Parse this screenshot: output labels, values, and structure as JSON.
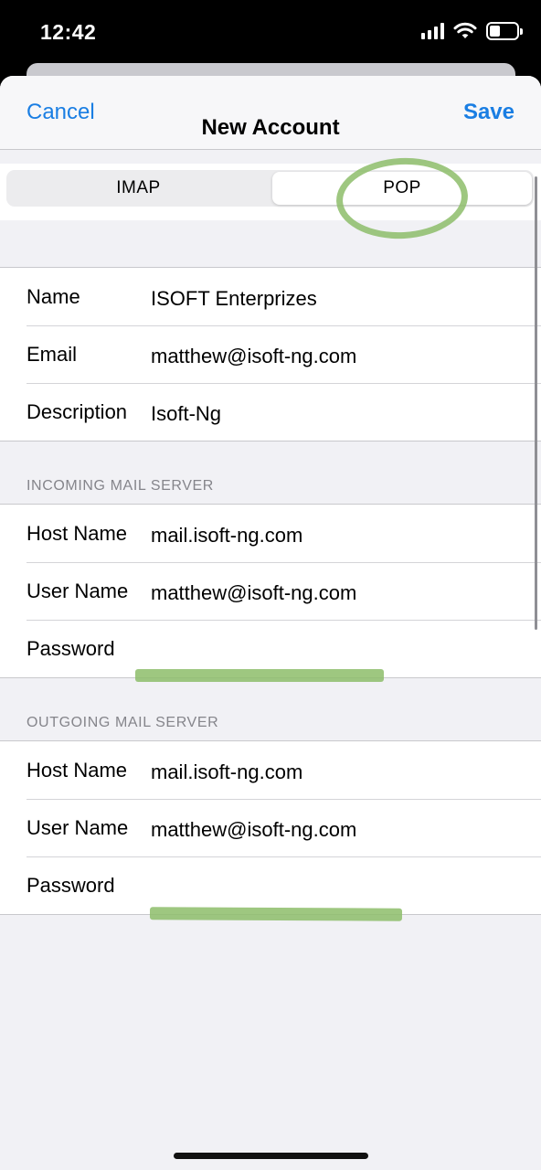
{
  "status_bar": {
    "time": "12:42",
    "signal_icon": "cellular-signal-icon",
    "wifi_icon": "wifi-icon",
    "battery_icon": "battery-icon",
    "battery_level": 0.4
  },
  "navbar": {
    "cancel_label": "Cancel",
    "title": "New Account",
    "save_label": "Save"
  },
  "segmented_control": {
    "options": [
      "IMAP",
      "POP"
    ],
    "selected": "POP"
  },
  "account": {
    "rows": [
      {
        "label": "Name",
        "value": "ISOFT Enterprizes"
      },
      {
        "label": "Email",
        "value": "matthew@isoft-ng.com"
      },
      {
        "label": "Description",
        "value": "Isoft-Ng"
      }
    ]
  },
  "incoming": {
    "header": "INCOMING MAIL SERVER",
    "rows": [
      {
        "label": "Host Name",
        "value": "mail.isoft-ng.com"
      },
      {
        "label": "User Name",
        "value": "matthew@isoft-ng.com"
      },
      {
        "label": "Password",
        "value": ""
      }
    ]
  },
  "outgoing": {
    "header": "OUTGOING MAIL SERVER",
    "rows": [
      {
        "label": "Host Name",
        "value": "mail.isoft-ng.com"
      },
      {
        "label": "User Name",
        "value": "matthew@isoft-ng.com"
      },
      {
        "label": "Password",
        "value": ""
      }
    ]
  },
  "colors": {
    "accent": "#1a7ee3",
    "annotation": "#8dbd6a",
    "grouped_background": "#f1f1f5"
  }
}
